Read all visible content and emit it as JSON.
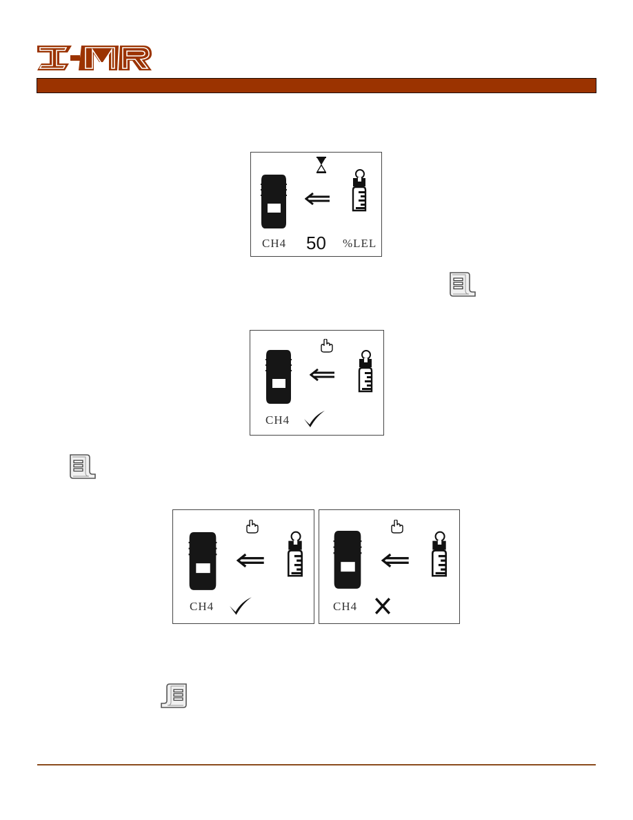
{
  "header": {
    "logo_text": "IMR",
    "brand_color": "#9b3300",
    "footer_line_color": "#8a4a1c"
  },
  "figures": [
    {
      "id": "calibration-in-progress",
      "status_icon": "hourglass-icon",
      "gas_label": "CH4",
      "value": "50",
      "unit": "%LEL"
    },
    {
      "id": "calibration-complete",
      "status_icon": "hand-pointer-icon",
      "gas_label": "CH4",
      "result_icon": "checkmark-icon"
    },
    {
      "id": "calibration-pass",
      "status_icon": "hand-pointer-icon",
      "gas_label": "CH4",
      "result_icon": "checkmark-icon"
    },
    {
      "id": "calibration-fail",
      "status_icon": "hand-pointer-icon",
      "gas_label": "CH4",
      "result_icon": "x-mark-icon"
    }
  ],
  "menu_key_icons": [
    {
      "name": "menu-key-icon",
      "orientation": "right-curl"
    },
    {
      "name": "menu-key-icon",
      "orientation": "right-curl"
    },
    {
      "name": "menu-key-icon",
      "orientation": "left-curl"
    }
  ]
}
